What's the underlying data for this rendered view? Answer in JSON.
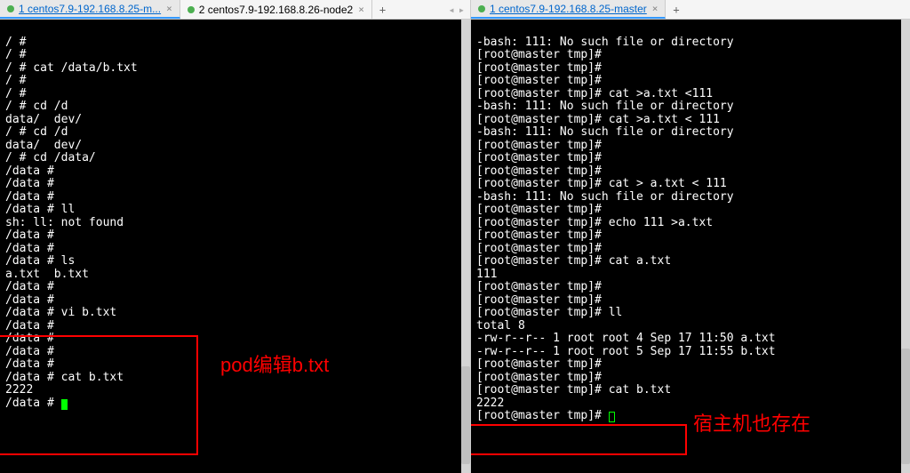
{
  "left": {
    "tabs": [
      {
        "label": "1 centos7.9-192.168.8.25-m...",
        "active": true
      },
      {
        "label": "2 centos7.9-192.168.8.26-node2",
        "active": false
      }
    ],
    "lines": [
      "/ #",
      "/ #",
      "/ # cat /data/b.txt",
      "/ #",
      "/ #",
      "/ # cd /d",
      "data/  dev/",
      "/ # cd /d",
      "data/  dev/",
      "/ # cd /data/",
      "/data #",
      "/data #",
      "/data #",
      "/data # ll",
      "sh: ll: not found",
      "/data #",
      "/data #",
      "/data # ls",
      "a.txt  b.txt",
      "/data #",
      "/data #",
      "/data # vi b.txt",
      "/data #",
      "/data #",
      "/data #",
      "/data #",
      "/data # cat b.txt",
      "2222",
      "/data # "
    ],
    "annotation_text": "pod编辑b.txt"
  },
  "right": {
    "tabs": [
      {
        "label": "1 centos7.9-192.168.8.25-master",
        "active": true
      }
    ],
    "lines": [
      "-bash: 111: No such file or directory",
      "[root@master tmp]#",
      "[root@master tmp]#",
      "[root@master tmp]#",
      "[root@master tmp]# cat >a.txt <111",
      "-bash: 111: No such file or directory",
      "[root@master tmp]# cat >a.txt < 111",
      "-bash: 111: No such file or directory",
      "[root@master tmp]#",
      "[root@master tmp]#",
      "[root@master tmp]#",
      "[root@master tmp]# cat > a.txt < 111",
      "-bash: 111: No such file or directory",
      "[root@master tmp]#",
      "[root@master tmp]# echo 111 >a.txt",
      "[root@master tmp]#",
      "[root@master tmp]#",
      "[root@master tmp]# cat a.txt",
      "111",
      "[root@master tmp]#",
      "[root@master tmp]#",
      "[root@master tmp]# ll",
      "total 8",
      "-rw-r--r-- 1 root root 4 Sep 17 11:50 a.txt",
      "-rw-r--r-- 1 root root 5 Sep 17 11:55 b.txt",
      "[root@master tmp]#",
      "[root@master tmp]#",
      "[root@master tmp]# cat b.txt",
      "2222",
      "[root@master tmp]# "
    ],
    "annotation_text": "宿主机也存在"
  }
}
